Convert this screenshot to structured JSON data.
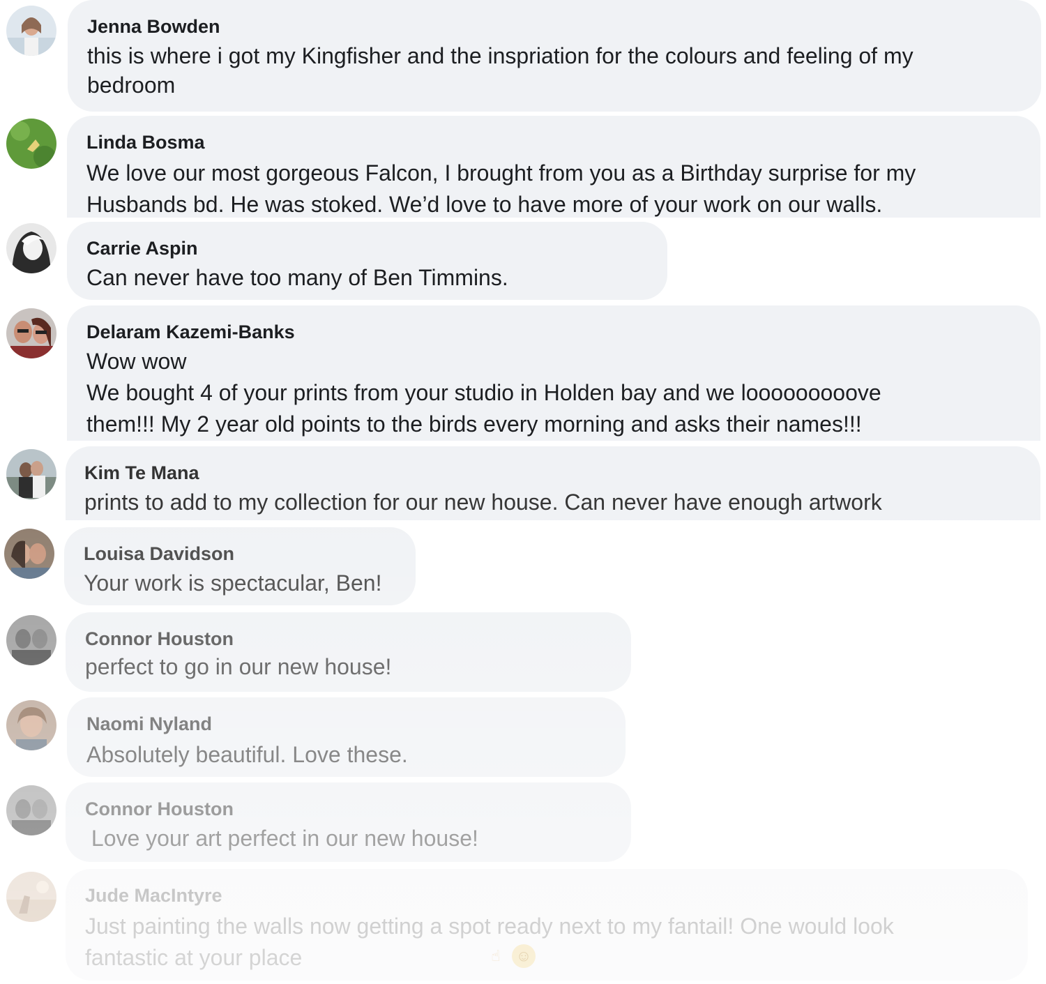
{
  "comments": [
    {
      "name": "Jenna Bowden",
      "lines": [
        "this is where i got my Kingfisher and the inspriation for the colours and  feeling of my",
        "bedroom"
      ]
    },
    {
      "name": "Linda Bosma",
      "lines": [
        "We love our most gorgeous Falcon, I brought from you as a Birthday surprise for my",
        "Husbands bd. He was stoked. We’d love to have more of your work on our walls."
      ]
    },
    {
      "name": "Carrie Aspin",
      "lines": [
        "Can never have too many of Ben Timmins."
      ]
    },
    {
      "name": "Delaram Kazemi-Banks",
      "lines": [
        "Wow wow",
        "We bought 4 of your prints from your studio in Holden bay and we looooooooove",
        "them!!! My 2 year old points to the birds every morning and asks their names!!!"
      ]
    },
    {
      "name": "Kim Te Mana",
      "lines": [
        "prints to add to my collection for our new house. Can never have enough artwork"
      ]
    },
    {
      "name": "Louisa Davidson",
      "lines": [
        "Your work is spectacular, Ben!"
      ]
    },
    {
      "name": "Connor Houston",
      "lines": [
        "perfect to go in our new house!"
      ]
    },
    {
      "name": "Naomi Nyland",
      "lines": [
        "Absolutely beautiful. Love these."
      ]
    },
    {
      "name": "Connor Houston",
      "lines": [
        " Love your art perfect in our new house!"
      ]
    },
    {
      "name": "Jude MacIntyre",
      "lines": [
        "Just painting the walls now getting a spot ready next to my fantail! One would look",
        "fantastic at your place"
      ],
      "emoji": [
        "pointing-up-emoji",
        "smiling-face-emoji"
      ]
    }
  ],
  "colors": {
    "bubble": "#f0f2f5",
    "text": "#1c1e21"
  }
}
